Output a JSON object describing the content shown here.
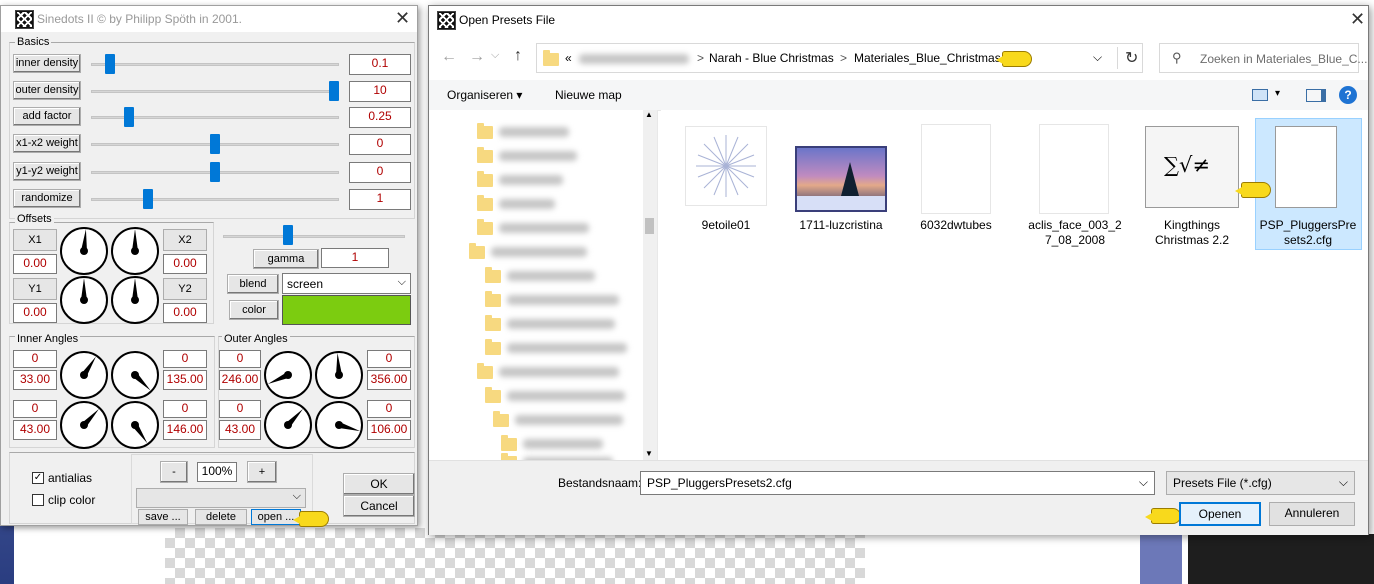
{
  "sinedots": {
    "title": "Sinedots II © by Philipp Spöth in 2001.",
    "basics_label": "Basics",
    "rows": [
      {
        "label": "inner density",
        "value": "0.1",
        "position": 0.06
      },
      {
        "label": "outer density",
        "value": "10",
        "position": 1.0
      },
      {
        "label": "add factor",
        "value": "0.25",
        "position": 0.14
      },
      {
        "label": "x1-x2 weight",
        "value": "0",
        "position": 0.5
      },
      {
        "label": "y1-y2 weight",
        "value": "0",
        "position": 0.5
      },
      {
        "label": "randomize",
        "value": "1",
        "position": 0.22
      }
    ],
    "offsets": {
      "label": "Offsets",
      "x1_label": "X1",
      "x1_value": "0.00",
      "x2_label": "X2",
      "x2_value": "0.00",
      "y1_label": "Y1",
      "y1_value": "0.00",
      "y2_label": "Y2",
      "y2_value": "0.00"
    },
    "gamma": {
      "label": "gamma",
      "value": "1",
      "position": 0.35
    },
    "blend": {
      "label": "blend",
      "value": "screen"
    },
    "color": {
      "label": "color",
      "swatch": "#7ccc10"
    },
    "inner_angles": {
      "label": "Inner Angles",
      "tl_small": "0",
      "tl_value": "33.00",
      "tr_small": "0",
      "tr_value": "135.00",
      "bl_small": "0",
      "bl_value": "43.00",
      "br_small": "0",
      "br_value": "146.00"
    },
    "outer_angles": {
      "label": "Outer Angles",
      "tl_small": "0",
      "tl_value": "246.00",
      "tr_small": "0",
      "tr_value": "356.00",
      "bl_small": "0",
      "bl_value": "43.00",
      "br_small": "0",
      "br_value": "106.00"
    },
    "antialias_label": "antialias",
    "antialias_checked": true,
    "clipcolor_label": "clip color",
    "clipcolor_checked": false,
    "zoom_minus": "-",
    "zoom_value": "100%",
    "zoom_plus": "+",
    "save_label": "save ...",
    "delete_label": "delete",
    "open_label": "open ...",
    "ok_label": "OK",
    "cancel_label": "Cancel"
  },
  "dialog": {
    "title": "Open Presets File",
    "crumb_prefix": "«",
    "crumbs": [
      "Narah - Blue Christmas",
      "Materiales_Blue_Christmas"
    ],
    "crumb_sep": ">",
    "search_placeholder": "Zoeken in Materiales_Blue_C...",
    "organise_label": "Organiseren ▾",
    "new_folder_label": "Nieuwe map",
    "files": [
      {
        "name": "9etoile01"
      },
      {
        "name": "1711-luzcristina"
      },
      {
        "name": "6032dwtubes"
      },
      {
        "name": "aclis_face_003_27_08_2008"
      },
      {
        "name": "Kingthings Christmas 2.2",
        "glyph": "∑√≠"
      },
      {
        "name": "PSP_PluggersPresets2.cfg"
      }
    ],
    "filename_label": "Bestandsnaam:",
    "filename_value": "PSP_PluggersPresets2.cfg",
    "filetype_value": "Presets File (*.cfg)",
    "open_label": "Openen",
    "cancel_label": "Annuleren"
  },
  "colors": {
    "accent": "#0078d7",
    "value_red": "#b00000",
    "selection": "#cce8ff"
  }
}
